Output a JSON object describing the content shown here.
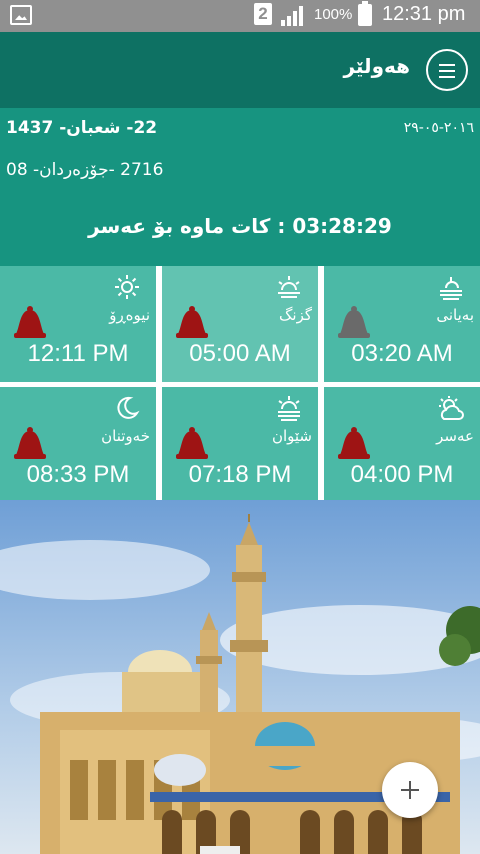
{
  "status_bar": {
    "sim_slot": "2",
    "battery_percent": "100%",
    "time": "12:31 pm",
    "icons": [
      "gallery-icon",
      "signal-icon",
      "battery-icon"
    ]
  },
  "app_bar": {
    "title": "هەولێر",
    "menu_icon": "menu-icon"
  },
  "info": {
    "hijri_date": "22- شعبان- 1437",
    "gregorian_date": "٢٠١٦-٠٥-٢٩",
    "kurdish_date": "2716 -جۆزەردان- 08",
    "countdown": "03:28:29 : کات ماوە بۆ عەسر"
  },
  "prayers": [
    {
      "name": "نیوەڕۆ",
      "time": "12:11 PM",
      "icon": "sun-icon",
      "alarm_on": true
    },
    {
      "name": "گزنگ",
      "time": "05:00 AM",
      "icon": "sunrise-icon",
      "alarm_on": true
    },
    {
      "name": "بەیانی",
      "time": "03:20 AM",
      "icon": "dawn-icon",
      "alarm_on": false
    },
    {
      "name": "خەوتنان",
      "time": "08:33 PM",
      "icon": "moon-icon",
      "alarm_on": true
    },
    {
      "name": "شێوان",
      "time": "07:18 PM",
      "icon": "sunset-icon",
      "alarm_on": true
    },
    {
      "name": "عەسر",
      "time": "04:00 PM",
      "icon": "cloud-sun-icon",
      "alarm_on": true
    }
  ],
  "colors": {
    "app_bar": "#0e7163",
    "info_panel": "#179480",
    "tile": "#4bb9a6",
    "tile_active": "#62c3b1",
    "alarm_on": "#9e1414",
    "alarm_off": "#6a6a6a"
  },
  "fab": {
    "icon": "plus-icon"
  }
}
